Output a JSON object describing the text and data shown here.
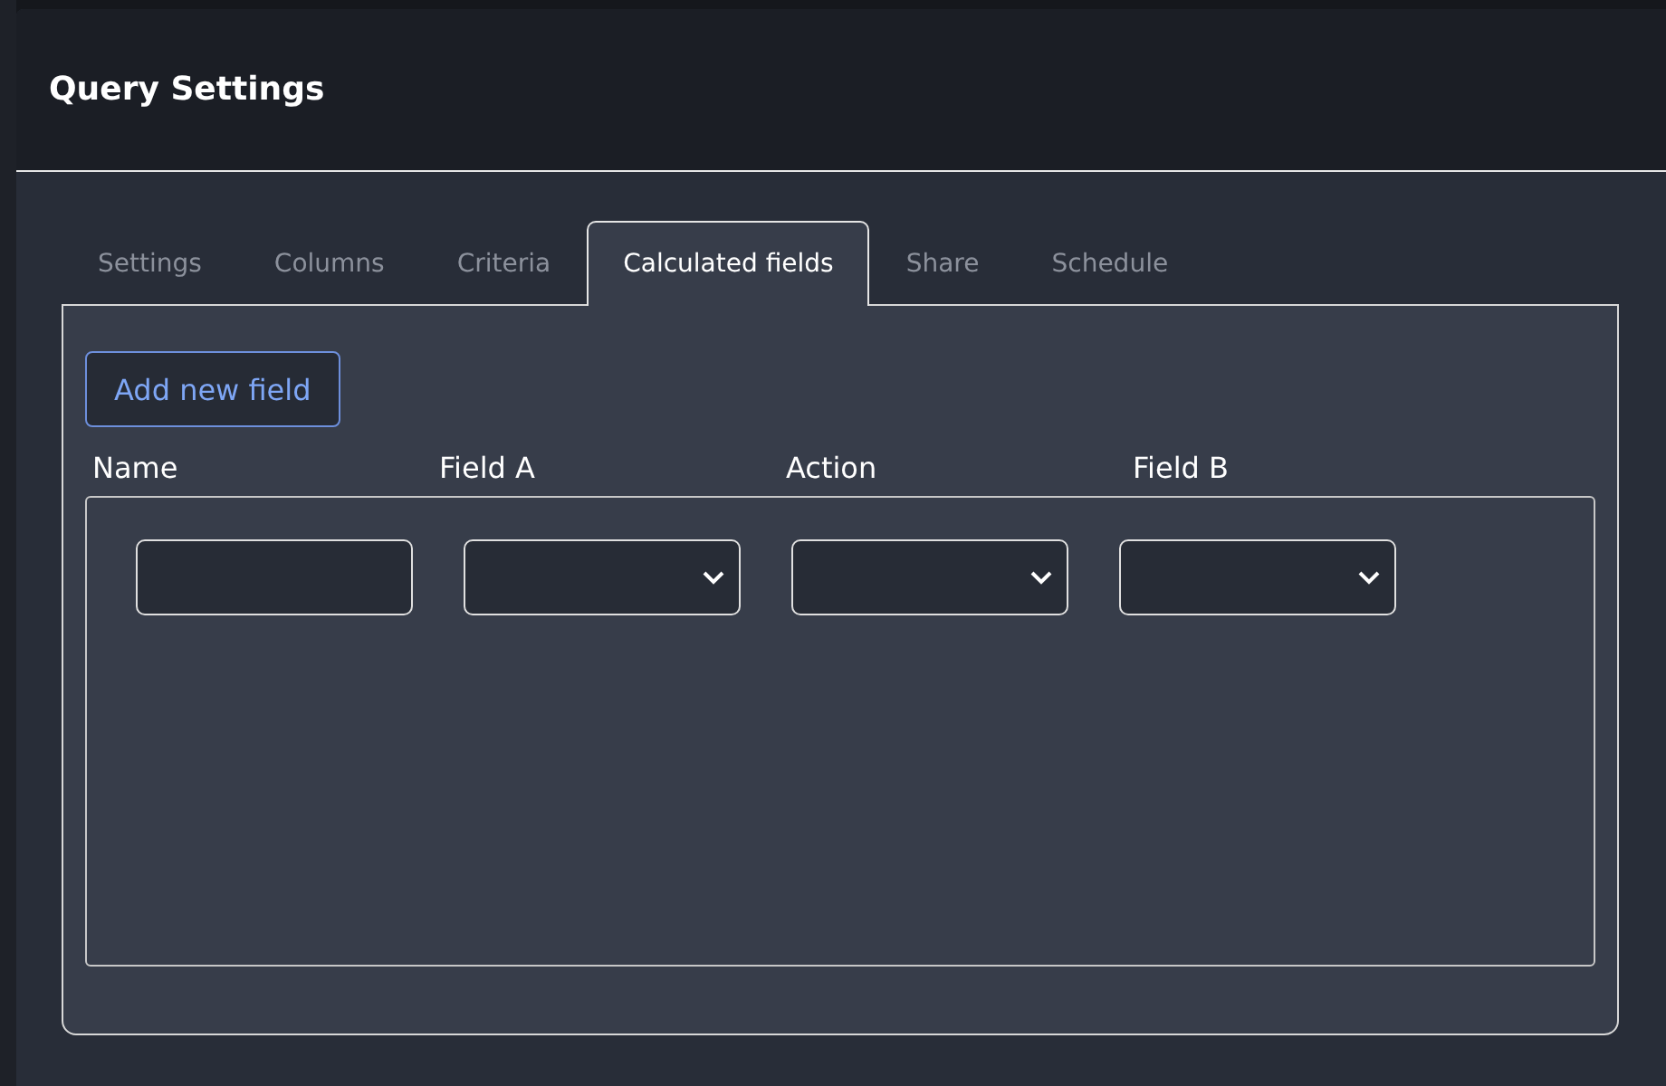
{
  "window": {
    "title": "Query Settings"
  },
  "tabs": [
    {
      "label": "Settings",
      "selected": false
    },
    {
      "label": "Columns",
      "selected": false
    },
    {
      "label": "Criteria",
      "selected": false
    },
    {
      "label": "Calculated fields",
      "selected": true
    },
    {
      "label": "Share",
      "selected": false
    },
    {
      "label": "Schedule",
      "selected": false
    }
  ],
  "add_button": "Add new field",
  "columns": [
    "Name",
    "Field A",
    "Action",
    "Field B"
  ],
  "rows": [
    {
      "fields": [
        {
          "kind": "text"
        },
        {
          "kind": "select"
        },
        {
          "kind": "select"
        },
        {
          "kind": "select"
        }
      ]
    }
  ]
}
